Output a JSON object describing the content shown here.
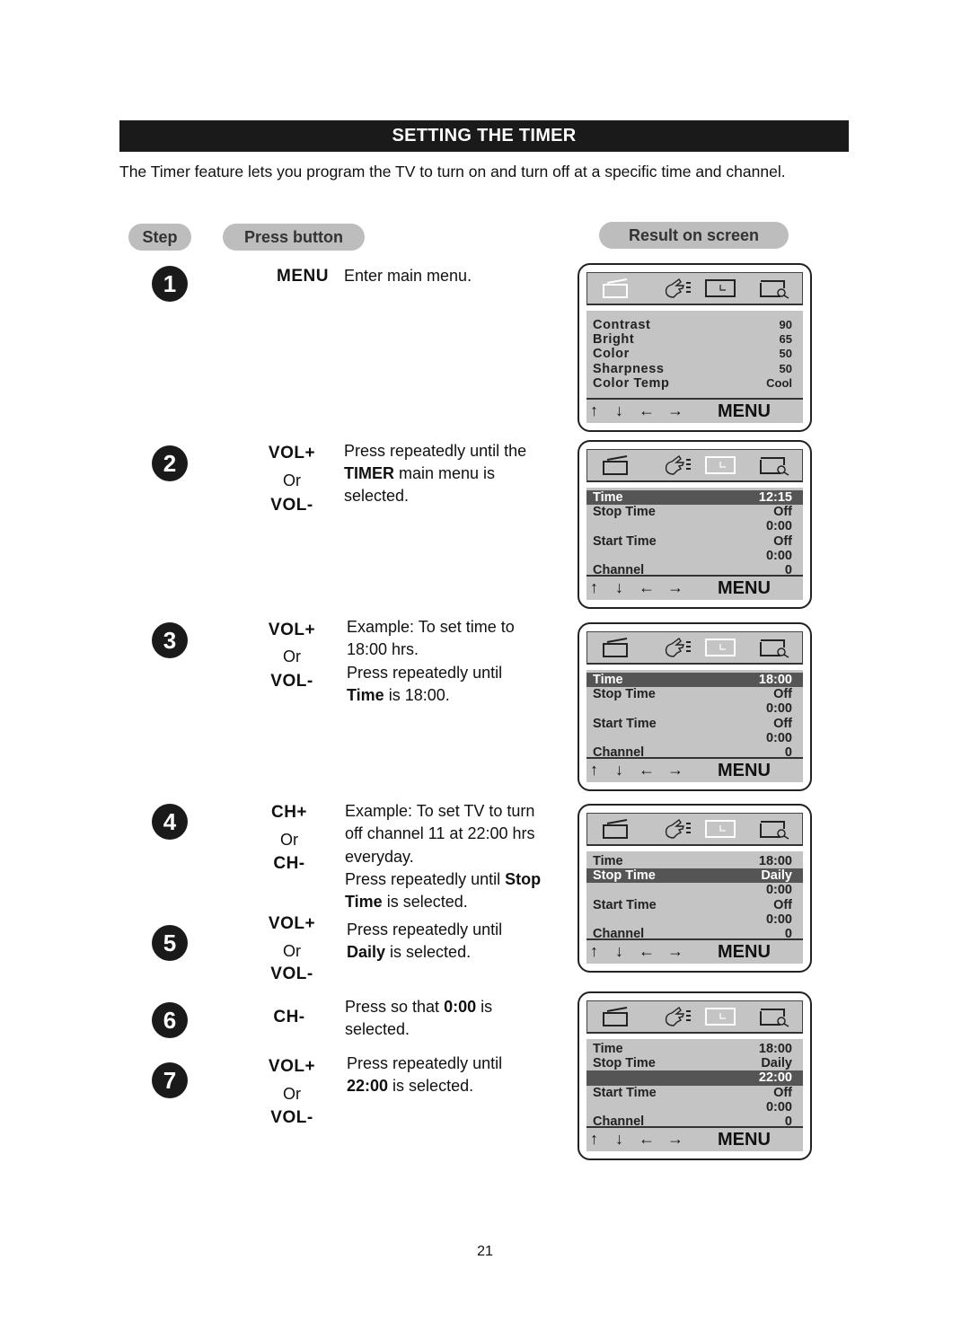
{
  "title": "SETTING THE TIMER",
  "intro": "The Timer feature lets you program the TV to turn on and turn off at a specific time and channel.",
  "headers": {
    "step": "Step",
    "press_button": "Press button",
    "result": "Result on screen"
  },
  "page_number": "21",
  "steps": [
    {
      "num": "1",
      "buttons": [
        "MENU"
      ],
      "desc": [
        [
          {
            "t": "Enter main menu."
          }
        ]
      ]
    },
    {
      "num": "2",
      "buttons": [
        "VOL+",
        "Or",
        "VOL-"
      ],
      "desc": [
        [
          {
            "t": "Press repeatedly until the"
          }
        ],
        [
          {
            "t": "TIMER",
            "b": true
          },
          {
            "t": " main menu is"
          }
        ],
        [
          {
            "t": "selected."
          }
        ]
      ]
    },
    {
      "num": "3",
      "buttons": [
        "VOL+",
        "Or",
        "VOL-"
      ],
      "desc": [
        [
          {
            "t": "Example: To set time to"
          }
        ],
        [
          {
            "t": "18:00 hrs."
          }
        ],
        [
          {
            "t": "Press repeatedly until"
          }
        ],
        [
          {
            "t": "Time",
            "b": true
          },
          {
            "t": " is 18:00."
          }
        ]
      ]
    },
    {
      "num": "4",
      "buttons": [
        "CH+",
        "Or",
        "CH-"
      ],
      "desc": [
        [
          {
            "t": "Example: To set TV to turn"
          }
        ],
        [
          {
            "t": "off channel 11 at 22:00 hrs"
          }
        ],
        [
          {
            "t": "everyday."
          }
        ],
        [
          {
            "t": "Press repeatedly until "
          },
          {
            "t": "Stop",
            "b": true
          }
        ],
        [
          {
            "t": "Time",
            "b": true
          },
          {
            "t": " is selected."
          }
        ]
      ]
    },
    {
      "num": "5",
      "buttons": [
        "VOL+",
        "Or",
        "VOL-"
      ],
      "desc": [
        [
          {
            "t": "Press repeatedly until"
          }
        ],
        [
          {
            "t": "Daily",
            "b": true
          },
          {
            "t": " is selected."
          }
        ]
      ]
    },
    {
      "num": "6",
      "buttons": [
        "CH-"
      ],
      "desc": [
        [
          {
            "t": "Press so that "
          },
          {
            "t": "0:00",
            "b": true
          },
          {
            "t": " is"
          }
        ],
        [
          {
            "t": "selected."
          }
        ]
      ]
    },
    {
      "num": "7",
      "buttons": [
        "VOL+",
        "Or",
        "VOL-"
      ],
      "desc": [
        [
          {
            "t": "Press repeatedly until"
          }
        ],
        [
          {
            "t": "22:00",
            "b": true
          },
          {
            "t": " is selected."
          }
        ]
      ]
    }
  ],
  "screens": [
    {
      "active_icon": "picture",
      "rows": [
        {
          "label": "Contrast",
          "value": "90"
        },
        {
          "label": "Bright",
          "value": "65"
        },
        {
          "label": "Color",
          "value": "50"
        },
        {
          "label": "Sharpness",
          "value": "50"
        },
        {
          "label": "Color Temp",
          "value": "Cool"
        }
      ]
    },
    {
      "active_icon": "timer",
      "rows": [
        {
          "label": "Time",
          "value": "12:15",
          "selected": true
        },
        {
          "label": "Stop Time",
          "value": "Off"
        },
        {
          "label": "",
          "value": "0:00"
        },
        {
          "label": "Start Time",
          "value": "Off"
        },
        {
          "label": "",
          "value": "0:00"
        },
        {
          "label": "Channel",
          "value": "0"
        }
      ]
    },
    {
      "active_icon": "timer",
      "rows": [
        {
          "label": "Time",
          "value": "18:00",
          "selected": true
        },
        {
          "label": "Stop Time",
          "value": "Off"
        },
        {
          "label": "",
          "value": "0:00"
        },
        {
          "label": "Start Time",
          "value": "Off"
        },
        {
          "label": "",
          "value": "0:00"
        },
        {
          "label": "Channel",
          "value": "0"
        }
      ]
    },
    {
      "active_icon": "timer",
      "rows": [
        {
          "label": "Time",
          "value": "18:00"
        },
        {
          "label": "Stop Time",
          "value": "Daily",
          "selected": true
        },
        {
          "label": "",
          "value": "0:00"
        },
        {
          "label": "Start Time",
          "value": "Off"
        },
        {
          "label": "",
          "value": "0:00"
        },
        {
          "label": "Channel",
          "value": "0"
        }
      ]
    },
    {
      "active_icon": "timer",
      "rows": [
        {
          "label": "Time",
          "value": "18:00"
        },
        {
          "label": "Stop Time",
          "value": "Daily"
        },
        {
          "label": "",
          "value": "22:00",
          "selected": true
        },
        {
          "label": "Start Time",
          "value": "Off"
        },
        {
          "label": "",
          "value": "0:00"
        },
        {
          "label": "Channel",
          "value": "0"
        }
      ]
    }
  ],
  "screen_nav": {
    "up": "up-arrow",
    "down": "down-arrow",
    "left": "left-arrow",
    "right": "right-arrow",
    "menu_label": "MENU"
  },
  "colors": {
    "title_bg": "#1a1a1a",
    "pill": "#bdbdbd",
    "screen_bg": "#c4c4c4",
    "highlight": "#555555"
  }
}
